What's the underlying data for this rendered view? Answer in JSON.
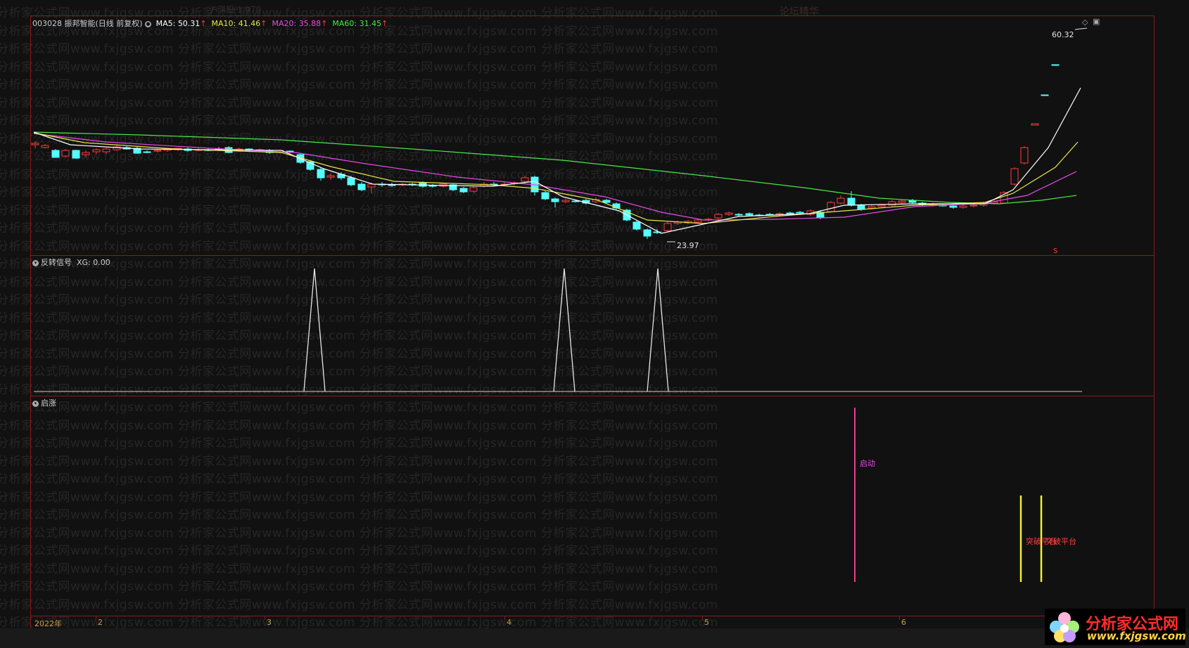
{
  "header": {
    "code": "003028",
    "name": "振邦智能",
    "period": "(日线 前复权)",
    "ma": [
      {
        "label": "MA5",
        "value": "50.31",
        "arrow": "↑",
        "color": "#ffffff"
      },
      {
        "label": "MA10",
        "value": "41.46",
        "arrow": "↑",
        "color": "#e8e84a"
      },
      {
        "label": "MA20",
        "value": "35.88",
        "arrow": "↑",
        "color": "#e84ae8"
      },
      {
        "label": "MA60",
        "value": "31.45",
        "arrow": "↑",
        "color": "#4ae84a"
      }
    ]
  },
  "price_pane": {
    "high_label": "60.32",
    "low_label": "23.97",
    "s_mark": "S"
  },
  "signal_pane": {
    "title": "反转信号",
    "value_label": "XG: 0.00"
  },
  "rise_pane": {
    "title": "启涨",
    "label_start": "启动",
    "label_break": "突破平台",
    "label_break2": "突破平台"
  },
  "time_axis": {
    "labels": [
      "2022年",
      "2",
      "3",
      "4",
      "5",
      "6"
    ]
  },
  "top_bg": {
    "text1": "沪深股 1.979",
    "text2": "论坛精华"
  },
  "logo": {
    "name": "分析家公式网",
    "url": "www.fxjgsw.com"
  },
  "watermark": {
    "text": "分析家公式网www.fxjgsw.com"
  },
  "colors": {
    "up": "#ff3c3c",
    "down": "#54ffff",
    "ma5": "#ffffff",
    "ma10": "#e8e84a",
    "ma20": "#e84ae8",
    "ma60": "#4ae84a",
    "grid": "#8a1a1a"
  }
}
